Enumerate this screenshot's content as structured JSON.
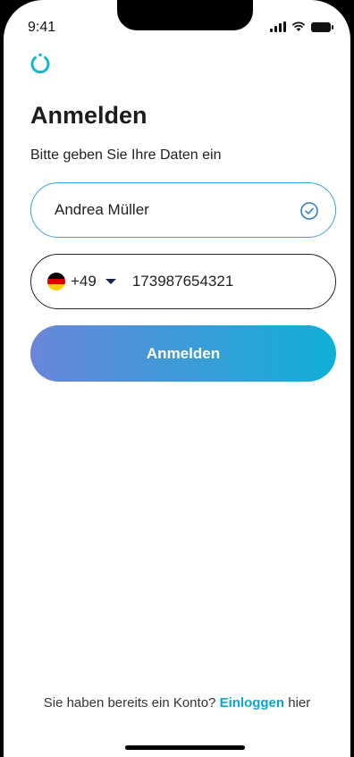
{
  "status_bar": {
    "time": "9:41"
  },
  "logo": "power-ring-icon",
  "page": {
    "title": "Anmelden",
    "subtitle": "Bitte geben Sie Ihre Daten ein"
  },
  "form": {
    "name_value": "Andrea Müller",
    "name_valid_icon": "check-circle-icon",
    "country_flag": "germany-flag-icon",
    "dial_code": "+49",
    "phone_value": "173987654321",
    "submit_label": "Anmelden"
  },
  "footer": {
    "prefix": "Sie haben bereits ein Konto?",
    "link": "Einloggen",
    "suffix": "hier"
  },
  "colors": {
    "accent": "#0aa6d2",
    "gradient_start": "#6a86d8",
    "gradient_end": "#0fb0d6",
    "dark_navy": "#1b2452"
  }
}
